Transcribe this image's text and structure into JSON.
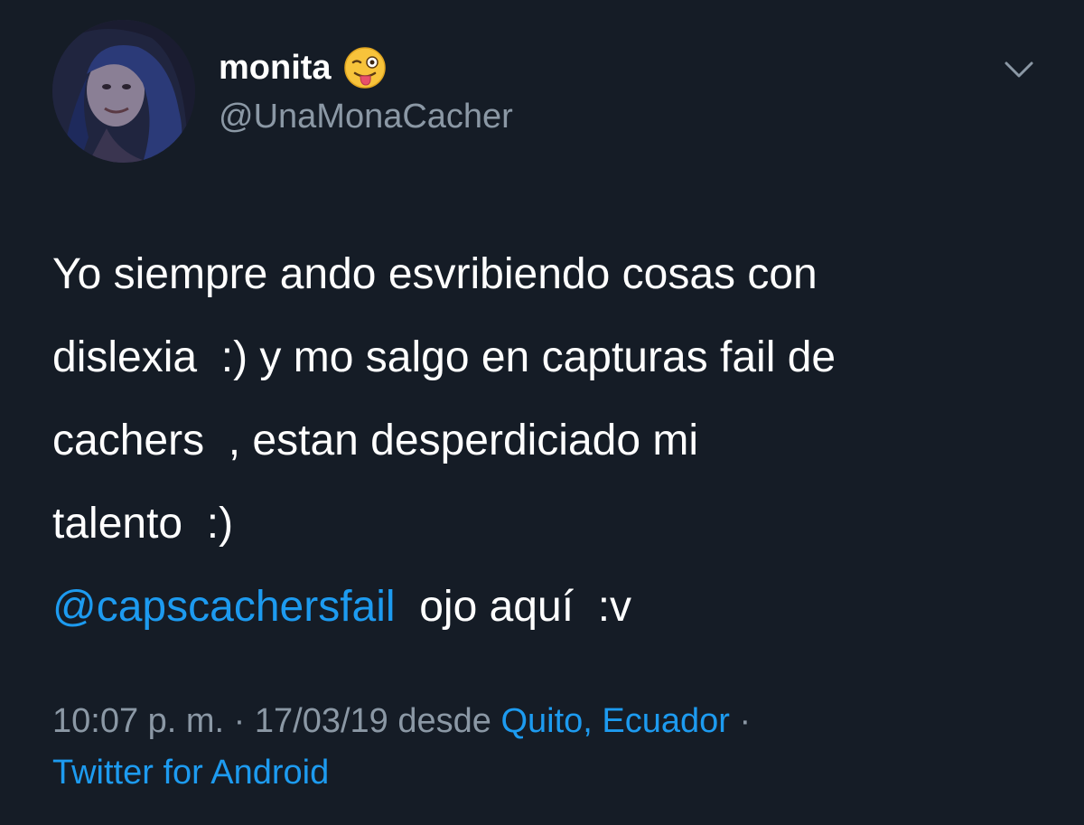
{
  "author": {
    "display_name": "monita",
    "emoji_icon": "winking-face-with-tongue-icon",
    "handle": "@UnaMonaCacher"
  },
  "tweet": {
    "lines": [
      "Yo siempre ando esvribiendo cosas con",
      "dislexia  :) y mo salgo en capturas fail de",
      "cachers  , estan desperdiciado mi",
      "talento  :)"
    ],
    "mention": "@capscachersfail",
    "after_mention": "  ojo aquí  :v"
  },
  "meta": {
    "time_date": "10:07 p. m. · 17/03/19 desde ",
    "location": "Quito, Ecuador",
    "separator": " ·",
    "source": "Twitter for Android"
  },
  "colors": {
    "background": "#151c26",
    "text": "#ffffff",
    "secondary": "#8b98a5",
    "link": "#1d9bf0"
  },
  "icons": {
    "menu": "chevron-down-icon",
    "avatar": "avatar"
  }
}
